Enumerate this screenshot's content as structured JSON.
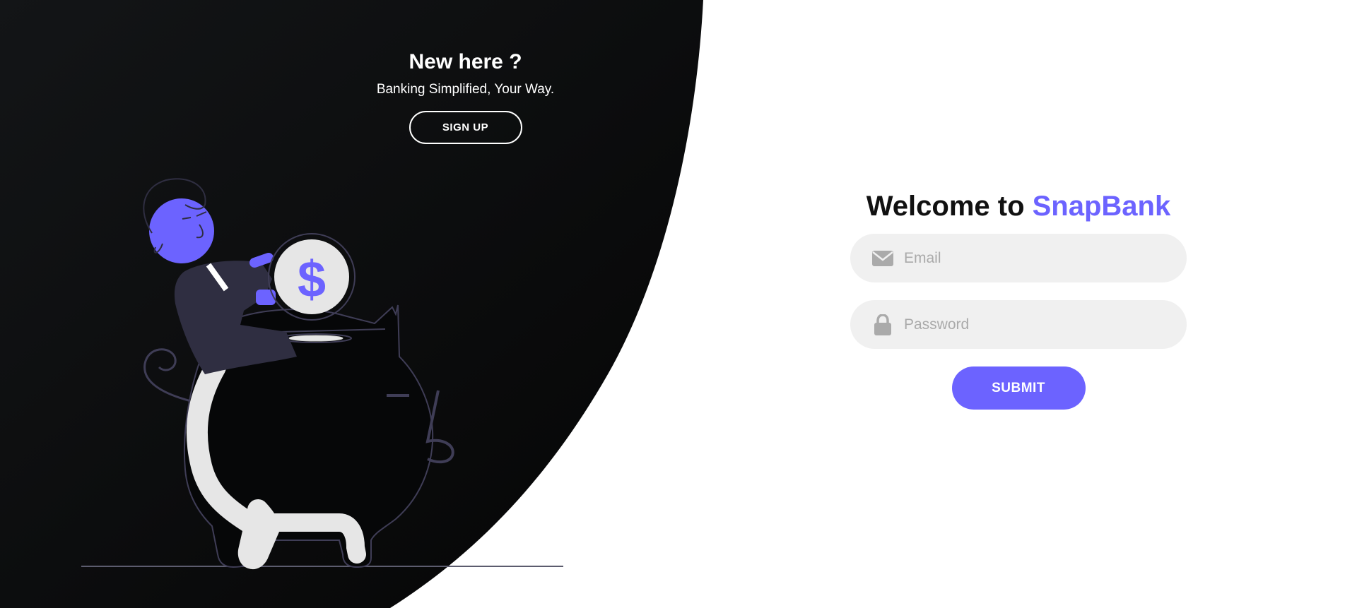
{
  "colors": {
    "dark_panel": "#0b0c0d",
    "accent": "#6c63ff",
    "input_bg": "#f0f0f0",
    "placeholder": "#aaaaaa"
  },
  "left_panel": {
    "title": "New here ?",
    "subtitle": "Banking Simplified, Your Way.",
    "signup_label": "SIGN UP",
    "illustration_icon": "person-with-piggy-bank-illustration",
    "coin_symbol": "$"
  },
  "login": {
    "title_prefix": "Welcome to ",
    "title_brand": "SnapBank",
    "email": {
      "placeholder": "Email",
      "value": "",
      "icon": "envelope-icon"
    },
    "password": {
      "placeholder": "Password",
      "value": "",
      "icon": "lock-icon"
    },
    "submit_label": "SUBMIT"
  }
}
